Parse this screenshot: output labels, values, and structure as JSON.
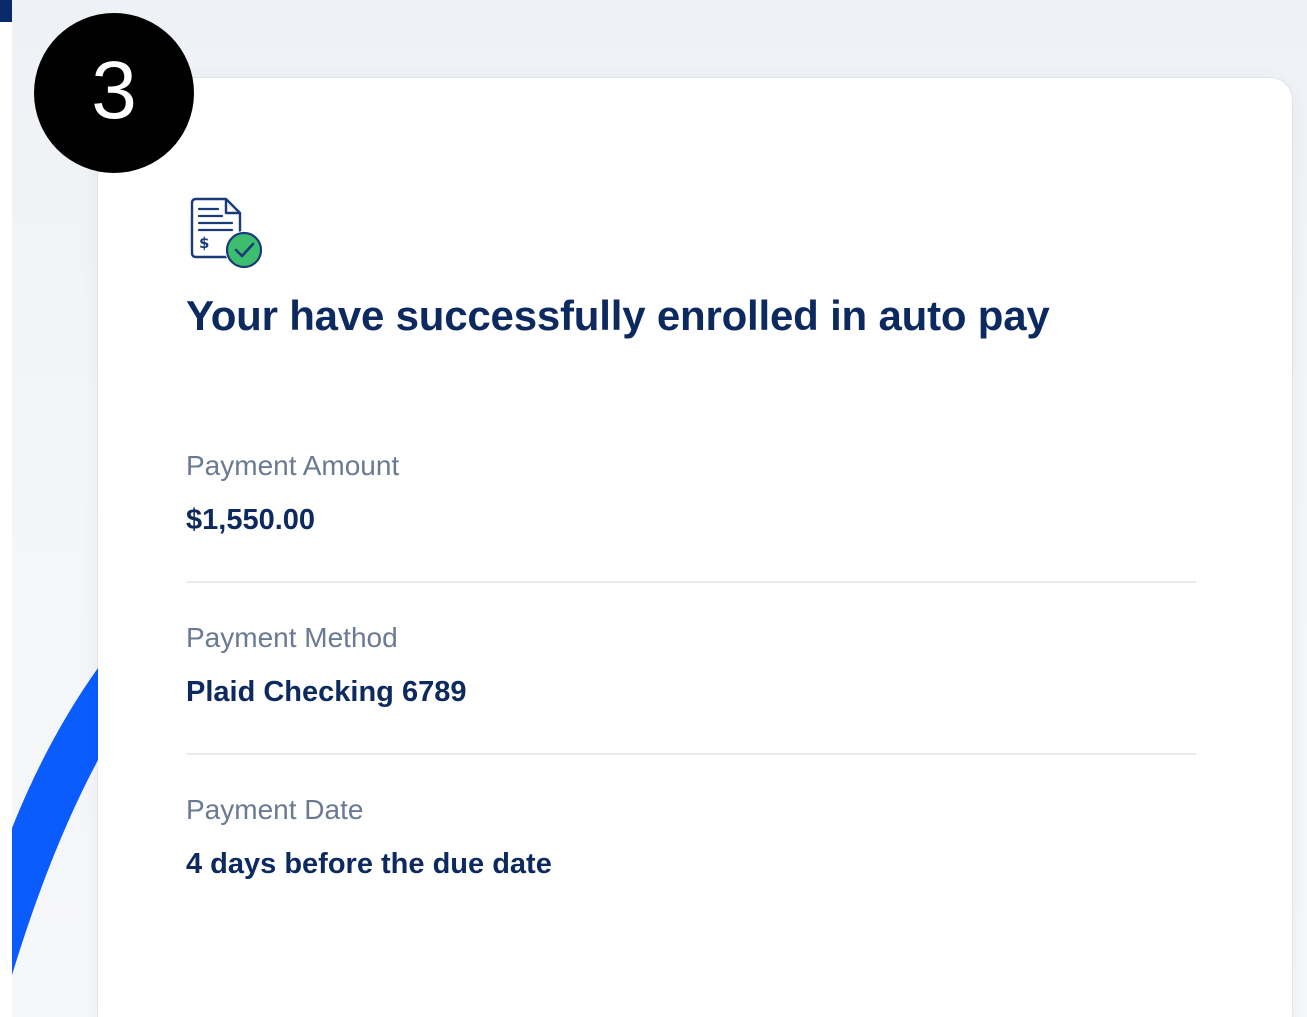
{
  "step_number": "3",
  "confirmation": {
    "title": "Your have successfully enrolled in auto pay",
    "icon": "invoice-check-icon",
    "details": [
      {
        "label": "Payment Amount",
        "value": "$1,550.00"
      },
      {
        "label": "Payment Method",
        "value": "Plaid Checking 6789"
      },
      {
        "label": "Payment Date",
        "value": "4 days before the due date"
      }
    ]
  },
  "colors": {
    "primary_text": "#0c2a5f",
    "label_text": "#6b7a93",
    "accent_blue": "#0a5cff",
    "success_green": "#3dbd6e",
    "badge": "#000000"
  }
}
